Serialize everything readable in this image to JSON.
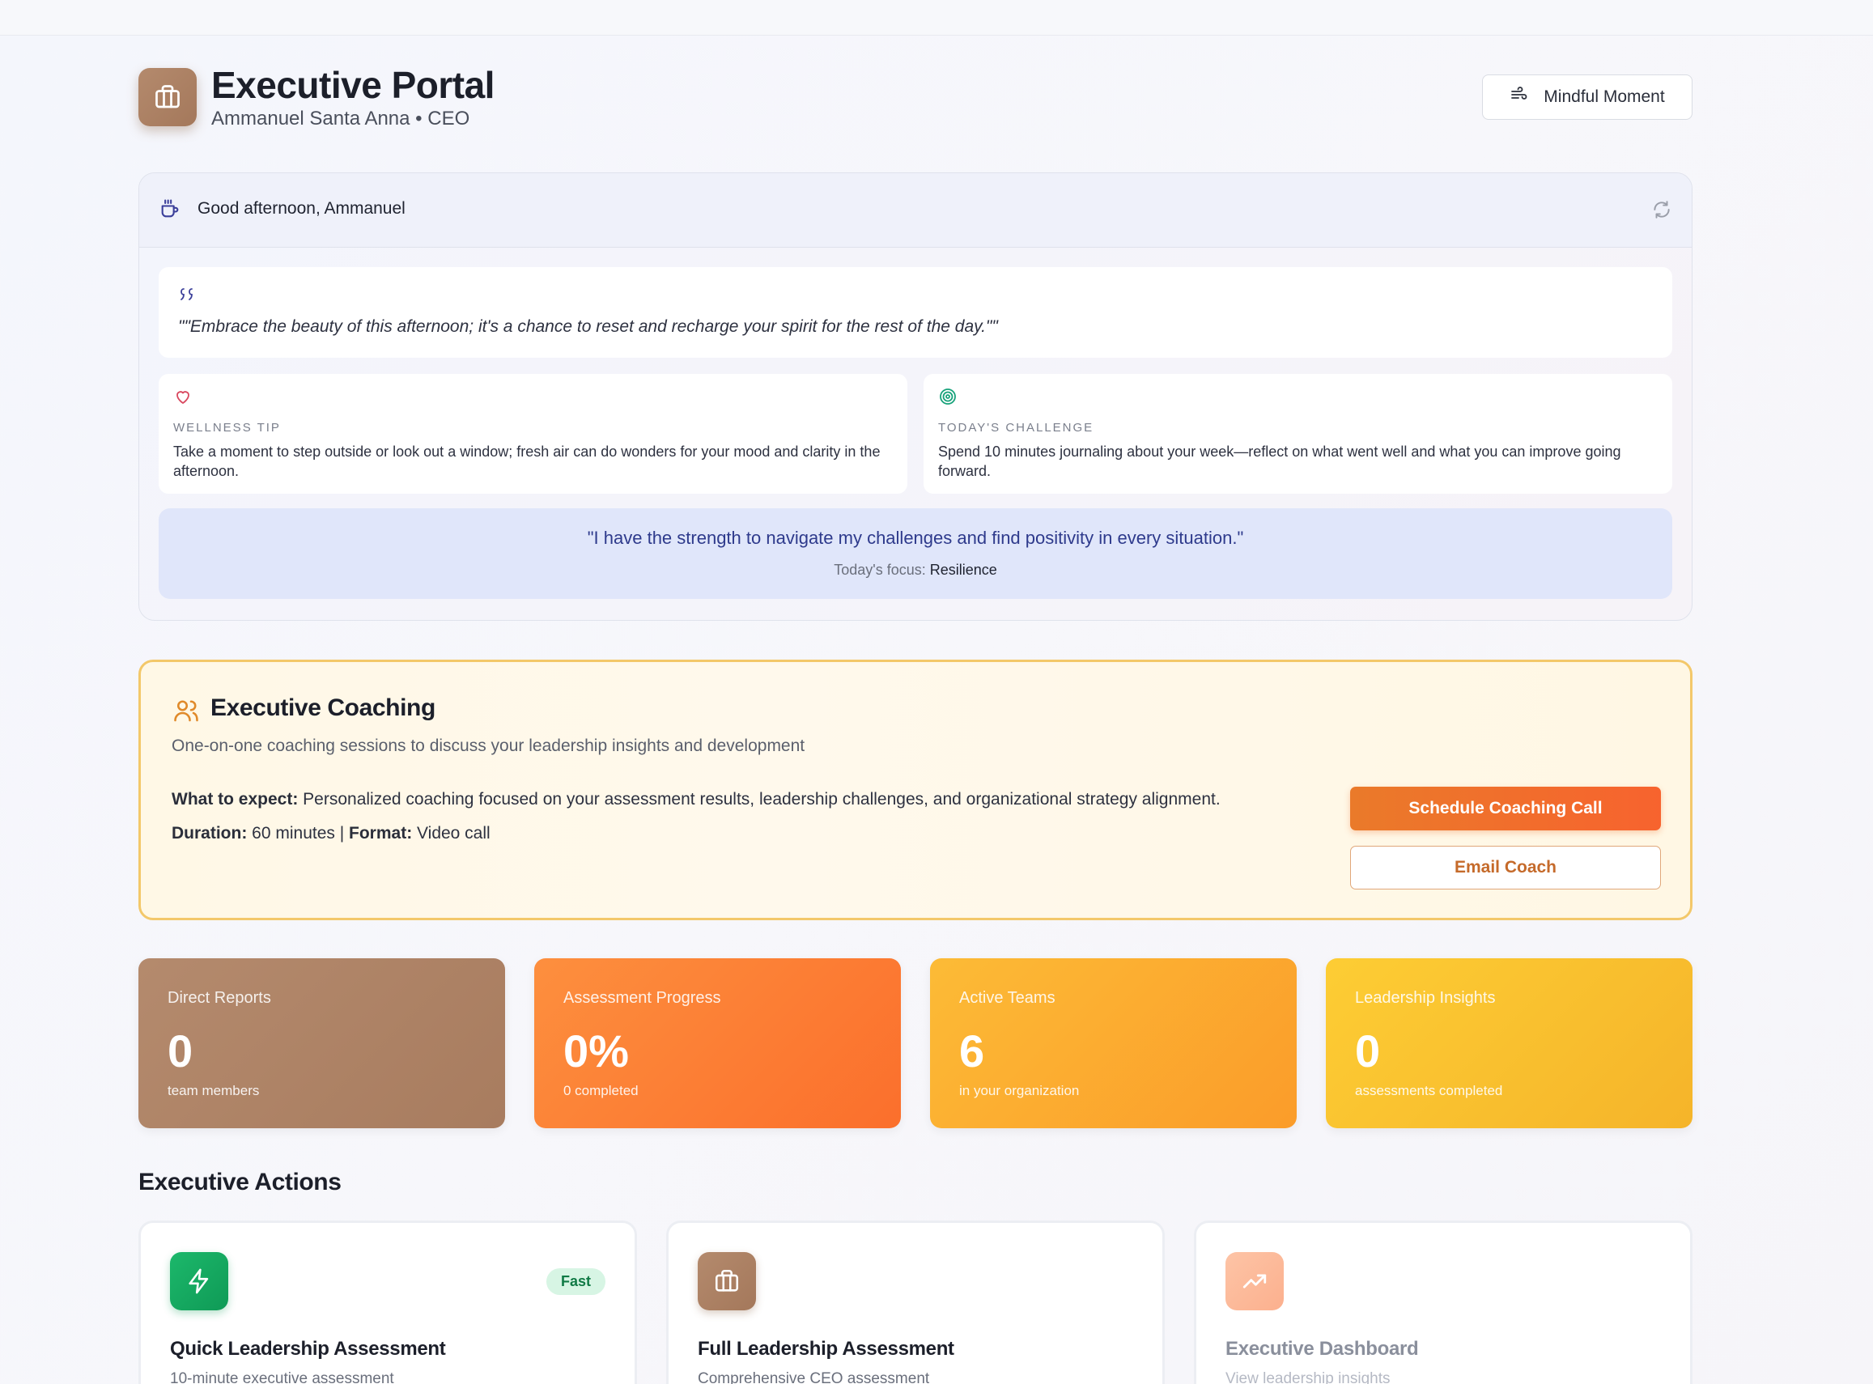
{
  "header": {
    "title": "Executive Portal",
    "subtitle": "Ammanuel Santa Anna • CEO",
    "mindful_label": "Mindful Moment"
  },
  "greeting": {
    "text": "Good afternoon, Ammanuel",
    "quote": "\"\"Embrace the beauty of this afternoon; it's a chance to reset and recharge your spirit for the rest of the day.\"\"",
    "wellness_label": "WELLNESS TIP",
    "wellness_text": "Take a moment to step outside or look out a window; fresh air can do wonders for your mood and clarity in the afternoon.",
    "challenge_label": "TODAY'S CHALLENGE",
    "challenge_text": "Spend 10 minutes journaling about your week—reflect on what went well and what you can improve going forward.",
    "affirmation": "\"I have the strength to navigate my challenges and find positivity in every situation.\"",
    "focus_prefix": "Today's focus: ",
    "focus_value": "Resilience"
  },
  "coaching": {
    "title": "Executive Coaching",
    "description": "One-on-one coaching sessions to discuss your leadership insights and development",
    "expect_label": "What to expect:",
    "expect_text": " Personalized coaching focused on your assessment results, leadership challenges, and organizational strategy alignment.",
    "duration_label": "Duration:",
    "duration_text": " 60 minutes | ",
    "format_label": "Format:",
    "format_text": " Video call",
    "schedule_label": "Schedule Coaching Call",
    "email_label": "Email Coach"
  },
  "stats": [
    {
      "label": "Direct Reports",
      "value": "0",
      "sub": "team members"
    },
    {
      "label": "Assessment Progress",
      "value": "0%",
      "sub": "0 completed"
    },
    {
      "label": "Active Teams",
      "value": "6",
      "sub": "in your organization"
    },
    {
      "label": "Leadership Insights",
      "value": "0",
      "sub": "assessments completed"
    }
  ],
  "actions": {
    "section_title": "Executive Actions",
    "items": [
      {
        "title": "Quick Leadership Assessment",
        "desc": "10-minute executive assessment",
        "badge": "Fast"
      },
      {
        "title": "Full Leadership Assessment",
        "desc": "Comprehensive CEO assessment"
      },
      {
        "title": "Executive Dashboard",
        "desc": "View leadership insights"
      }
    ]
  },
  "colors": {
    "brand_brown": "#a87c5f",
    "orange": "#f97a2e",
    "amber": "#f9ad2e",
    "yellow": "#f5c52c",
    "green": "#15a75e"
  }
}
